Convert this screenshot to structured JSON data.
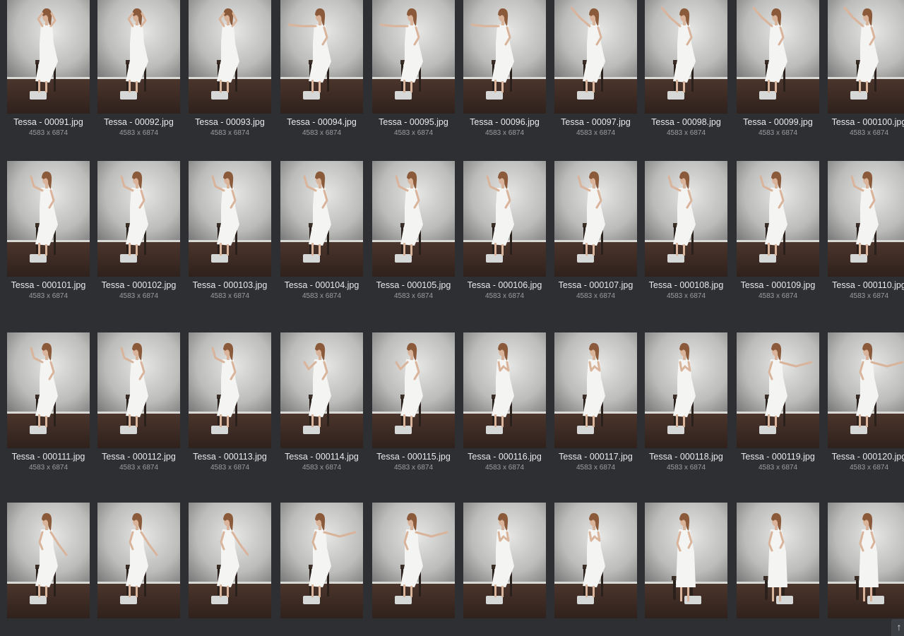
{
  "gallery": {
    "dimensions_label": "4583 x 6874",
    "items": [
      {
        "name": "Tessa - 00091.jpg",
        "pose": "hands-head"
      },
      {
        "name": "Tessa - 00092.jpg",
        "pose": "hands-head"
      },
      {
        "name": "Tessa - 00093.jpg",
        "pose": "hands-head"
      },
      {
        "name": "Tessa - 00094.jpg",
        "pose": "arm-left"
      },
      {
        "name": "Tessa - 00095.jpg",
        "pose": "arm-left"
      },
      {
        "name": "Tessa - 00096.jpg",
        "pose": "arm-left"
      },
      {
        "name": "Tessa - 00097.jpg",
        "pose": "arm-up-left"
      },
      {
        "name": "Tessa - 00098.jpg",
        "pose": "arm-up-left"
      },
      {
        "name": "Tessa - 00099.jpg",
        "pose": "arm-up-left"
      },
      {
        "name": "Tessa - 000100.jpg",
        "pose": "arm-up-left"
      },
      {
        "name": "Tessa - 000101.jpg",
        "pose": "arm-bent-up"
      },
      {
        "name": "Tessa - 000102.jpg",
        "pose": "arm-bent-up"
      },
      {
        "name": "Tessa - 000103.jpg",
        "pose": "arm-bent-up"
      },
      {
        "name": "Tessa - 000104.jpg",
        "pose": "arm-bent-up"
      },
      {
        "name": "Tessa - 000105.jpg",
        "pose": "arm-bent-up"
      },
      {
        "name": "Tessa - 000106.jpg",
        "pose": "arm-bent-up"
      },
      {
        "name": "Tessa - 000107.jpg",
        "pose": "arm-bent-up"
      },
      {
        "name": "Tessa - 000108.jpg",
        "pose": "arm-bent-up"
      },
      {
        "name": "Tessa - 000109.jpg",
        "pose": "arm-bent-up"
      },
      {
        "name": "Tessa - 000110.jpg",
        "pose": "arm-bent-up"
      },
      {
        "name": "Tessa - 000111.jpg",
        "pose": "arm-bent-up"
      },
      {
        "name": "Tessa - 000112.jpg",
        "pose": "arm-bent-up"
      },
      {
        "name": "Tessa - 000113.jpg",
        "pose": "arm-bent-up"
      },
      {
        "name": "Tessa - 000114.jpg",
        "pose": "arm-low"
      },
      {
        "name": "Tessa - 000115.jpg",
        "pose": "arm-low"
      },
      {
        "name": "Tessa - 000116.jpg",
        "pose": "hands-chest"
      },
      {
        "name": "Tessa - 000117.jpg",
        "pose": "hands-chest"
      },
      {
        "name": "Tessa - 000118.jpg",
        "pose": "hands-chest"
      },
      {
        "name": "Tessa - 000119.jpg",
        "pose": "arm-right"
      },
      {
        "name": "Tessa - 000120.jpg",
        "pose": "arm-right"
      },
      {
        "name": "",
        "pose": "arm-down-right"
      },
      {
        "name": "",
        "pose": "arm-down-right"
      },
      {
        "name": "",
        "pose": "arm-down-right"
      },
      {
        "name": "",
        "pose": "arm-right"
      },
      {
        "name": "",
        "pose": "arm-right"
      },
      {
        "name": "",
        "pose": "hands-chest"
      },
      {
        "name": "",
        "pose": "hands-chest"
      },
      {
        "name": "",
        "pose": "standing"
      },
      {
        "name": "",
        "pose": "standing"
      },
      {
        "name": "",
        "pose": "standing"
      }
    ]
  },
  "scroll_top_icon": "arrow-up-icon",
  "scroll_top_glyph": "↑",
  "colors": {
    "background": "#2d2f33",
    "filename_text": "#e9eaec",
    "dimension_text": "#9b9ea3"
  }
}
